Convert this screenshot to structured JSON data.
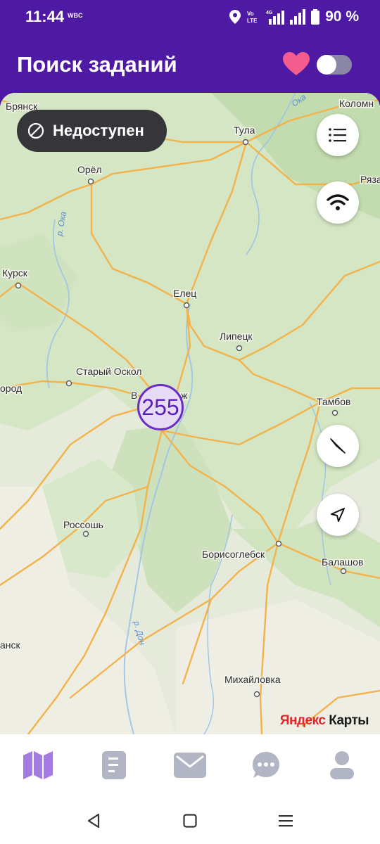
{
  "status_bar": {
    "time": "11:44",
    "carrier_tag": "WBC",
    "battery_percent": "90 %",
    "network_label": "4G",
    "volte_label": "Vo LTE"
  },
  "header": {
    "title": "Поиск заданий",
    "favorite_icon": "heart-icon",
    "toggle_on": false
  },
  "map": {
    "availability_label": "Недоступен",
    "cluster_count": "255",
    "attribution": {
      "part1": "Яндекс",
      "part2": " Карты"
    },
    "cities": {
      "bryansk": "Брянск",
      "tula": "Тула",
      "kolomna": "Коломн",
      "oryol": "Орёл",
      "ryaz": "Ряза",
      "kursk": "Курск",
      "elets": "Елец",
      "lipetsk": "Липецк",
      "stary_oskol": "Старый Оскол",
      "belgorod": "ород",
      "voronezh_start": "В",
      "voronezh_end": "ж",
      "tambov": "Тамбов",
      "rossosh": "Россошь",
      "borisoglebsk": "Борисоглебск",
      "balashov": "Балашов",
      "kantemirovka": "анск",
      "mikhaylovka": "Михайловка"
    },
    "rivers": {
      "oka_north": "Ока",
      "oka_west": "р. Ока",
      "don": "р. Дон"
    },
    "buttons": {
      "list": "list-icon",
      "wifi": "wifi-icon",
      "compass": "compass-icon",
      "locate": "location-arrow-icon"
    }
  },
  "bottom_nav": {
    "active_tab": "map",
    "tabs": [
      "map-icon",
      "document-icon",
      "mail-icon",
      "chat-icon",
      "profile-icon"
    ]
  },
  "colors": {
    "brand_purple": "#4f1aa3",
    "heart_pink": "#f25c8f",
    "active_tab": "#a47be0",
    "inactive_tab": "#b2b6c4",
    "forest_green": "#c5dfb3",
    "road_orange": "#f3b24a"
  }
}
